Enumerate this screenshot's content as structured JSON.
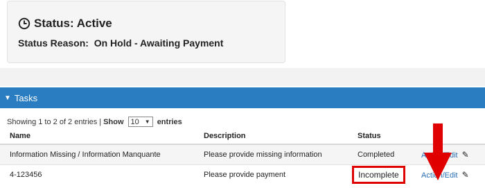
{
  "status_card": {
    "title": "Status: Active",
    "reason_label": "Status Reason:",
    "reason_value": "On Hold - Awaiting Payment"
  },
  "tasks": {
    "header": "Tasks",
    "showing_text": "Showing 1 to 2 of 2 entries |",
    "show_label": "Show",
    "page_size": "10",
    "entries_label": "entries",
    "columns": [
      "Name",
      "Description",
      "Status",
      ""
    ],
    "rows": [
      {
        "name": "Information Missing / Information Manquante",
        "description": "Please provide missing information",
        "status": "Completed",
        "action": "Action/Edit"
      },
      {
        "name": "4-123456",
        "description": "Please provide payment",
        "status": "Incomplete",
        "action": "Action/Edit"
      }
    ]
  },
  "colors": {
    "header_blue": "#2a7dc1",
    "highlight_red": "#e00000",
    "link_blue": "#2a6fb4"
  },
  "icons": {
    "status": "clock-icon",
    "edit": "pencil-icon",
    "collapse": "caret-down-icon",
    "annotation": "red-down-arrow"
  }
}
